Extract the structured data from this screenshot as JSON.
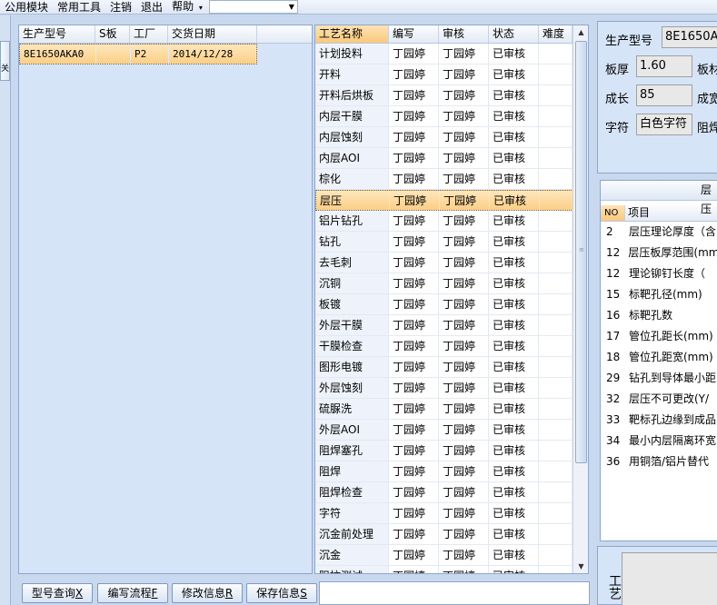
{
  "menu": {
    "items": [
      "公用模块",
      "常用工具",
      "注销",
      "退出",
      "帮助"
    ],
    "help_arrow": "▾",
    "combo_value": ""
  },
  "left_strip": {
    "label": "关"
  },
  "model_grid": {
    "columns": [
      "生产型号",
      "S板",
      "工厂",
      "交货日期"
    ],
    "rows": [
      {
        "model": "8E1650AKA0",
        "s": "",
        "factory": "P2",
        "date": "2014/12/28"
      }
    ]
  },
  "process_grid": {
    "columns": [
      "工艺名称",
      "编写",
      "审核",
      "状态",
      "难度"
    ],
    "rows": [
      [
        "计划投料",
        "丁园婷",
        "丁园婷",
        "已审核",
        ""
      ],
      [
        "开料",
        "丁园婷",
        "丁园婷",
        "已审核",
        ""
      ],
      [
        "开料后烘板",
        "丁园婷",
        "丁园婷",
        "已审核",
        ""
      ],
      [
        "内层干膜",
        "丁园婷",
        "丁园婷",
        "已审核",
        ""
      ],
      [
        "内层蚀刻",
        "丁园婷",
        "丁园婷",
        "已审核",
        ""
      ],
      [
        "内层AOI",
        "丁园婷",
        "丁园婷",
        "已审核",
        ""
      ],
      [
        "棕化",
        "丁园婷",
        "丁园婷",
        "已审核",
        ""
      ],
      [
        "层压",
        "丁园婷",
        "丁园婷",
        "已审核",
        ""
      ],
      [
        "铝片钻孔",
        "丁园婷",
        "丁园婷",
        "已审核",
        ""
      ],
      [
        "钻孔",
        "丁园婷",
        "丁园婷",
        "已审核",
        ""
      ],
      [
        "去毛刺",
        "丁园婷",
        "丁园婷",
        "已审核",
        ""
      ],
      [
        "沉铜",
        "丁园婷",
        "丁园婷",
        "已审核",
        ""
      ],
      [
        "板镀",
        "丁园婷",
        "丁园婷",
        "已审核",
        ""
      ],
      [
        "外层干膜",
        "丁园婷",
        "丁园婷",
        "已审核",
        ""
      ],
      [
        "干膜检查",
        "丁园婷",
        "丁园婷",
        "已审核",
        ""
      ],
      [
        "图形电镀",
        "丁园婷",
        "丁园婷",
        "已审核",
        ""
      ],
      [
        "外层蚀刻",
        "丁园婷",
        "丁园婷",
        "已审核",
        ""
      ],
      [
        "硫脲洗",
        "丁园婷",
        "丁园婷",
        "已审核",
        ""
      ],
      [
        "外层AOI",
        "丁园婷",
        "丁园婷",
        "已审核",
        ""
      ],
      [
        "阻焊塞孔",
        "丁园婷",
        "丁园婷",
        "已审核",
        ""
      ],
      [
        "阻焊",
        "丁园婷",
        "丁园婷",
        "已审核",
        ""
      ],
      [
        "阻焊检查",
        "丁园婷",
        "丁园婷",
        "已审核",
        ""
      ],
      [
        "字符",
        "丁园婷",
        "丁园婷",
        "已审核",
        ""
      ],
      [
        "沉金前处理",
        "丁园婷",
        "丁园婷",
        "已审核",
        ""
      ],
      [
        "沉金",
        "丁园婷",
        "丁园婷",
        "已审核",
        ""
      ],
      [
        "阻抗测试",
        "丁园婷",
        "丁园婷",
        "已审核",
        ""
      ]
    ],
    "selected_index": 7
  },
  "buttons": {
    "query": "型号查询",
    "query_key": "X",
    "write_flow": "编写流程",
    "write_flow_key": "F",
    "modify": "修改信息",
    "modify_key": "R",
    "save": "保存信息",
    "save_key": "S"
  },
  "detail_form": {
    "model_label": "生产型号",
    "model_value": "8E1650A",
    "thickness_label": "板厚",
    "thickness_value": "1.60",
    "material_label": "板材",
    "length_label": "成长",
    "length_value": "85",
    "width_label": "成宽",
    "char_label": "字符",
    "char_value": "白色字符",
    "solder_label": "阻焊"
  },
  "param_grid": {
    "title": "层压",
    "col_no": "NO",
    "col_item": "项目",
    "rows": [
      {
        "no": "2",
        "item": "层压理论厚度（含"
      },
      {
        "no": "12",
        "item": "层压板厚范围(mm"
      },
      {
        "no": "12",
        "item": "理论铆钉长度（"
      },
      {
        "no": "15",
        "item": "标靶孔径(mm)"
      },
      {
        "no": "16",
        "item": "标靶孔数"
      },
      {
        "no": "17",
        "item": "管位孔距长(mm)"
      },
      {
        "no": "18",
        "item": "管位孔距宽(mm)"
      },
      {
        "no": "29",
        "item": "钻孔到导体最小距"
      },
      {
        "no": "32",
        "item": "层压不可更改(Y/"
      },
      {
        "no": "33",
        "item": "靶标孔边缘到成品"
      },
      {
        "no": "34",
        "item": "最小内层隔离环宽"
      },
      {
        "no": "36",
        "item": "用铜箔/铝片替代"
      }
    ]
  },
  "bottom_right": {
    "label": "工艺"
  }
}
